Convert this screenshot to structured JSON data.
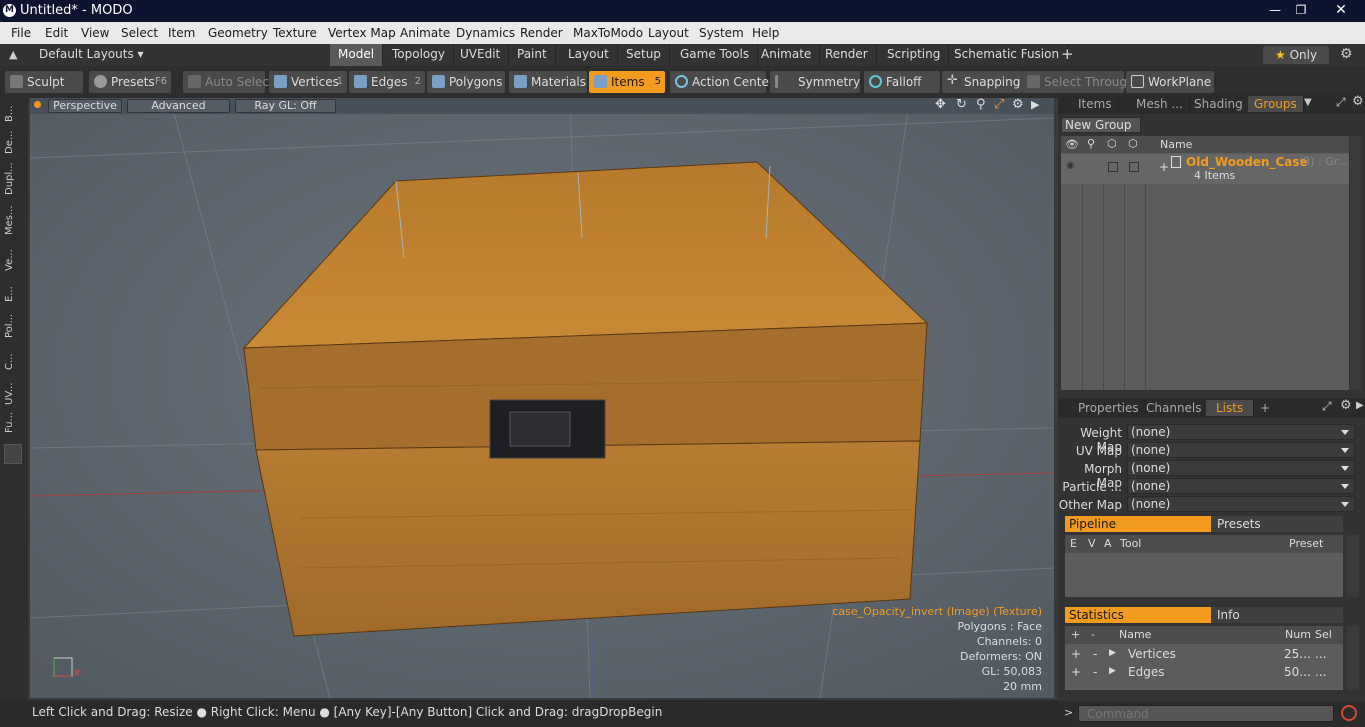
{
  "window": {
    "title": "Untitled* - MODO",
    "logo": "M"
  },
  "menu": [
    "File",
    "Edit",
    "View",
    "Select",
    "Item",
    "Geometry",
    "Texture",
    "Vertex Map",
    "Animate",
    "Dynamics",
    "Render",
    "MaxToModo",
    "Layout",
    "System",
    "Help"
  ],
  "layout_selector": "Default Layouts",
  "layout_tabs": [
    "Model",
    "Topology",
    "UVEdit",
    "Paint",
    "Layout",
    "Setup",
    "Game Tools",
    "Animate",
    "Render",
    "Scripting",
    "Schematic Fusion",
    "+"
  ],
  "only_label": "Only",
  "tools": {
    "sculpt": "Sculpt",
    "presets": "Presets",
    "presets_key": "F6",
    "auto_select": "Auto Select",
    "vertices": "Vertices",
    "vertices_key": "1",
    "edges": "Edges",
    "edges_key": "2",
    "polygons": "Polygons",
    "materials": "Materials",
    "items": "Items",
    "items_key": "5",
    "action_center": "Action Center",
    "symmetry": "Symmetry",
    "falloff": "Falloff",
    "snapping": "Snapping",
    "select_through": "Select Through",
    "workplane": "WorkPlane"
  },
  "left_tabs": [
    "B...",
    "De...",
    "Dupl...",
    "Mes...",
    "Ve...",
    "E...",
    "Pol...",
    "C...",
    "UV...",
    "Fu..."
  ],
  "viewport": {
    "perspective": "Perspective",
    "advanced": "Advanced",
    "raygl": "Ray GL: Off",
    "info": [
      "case_Opacity_invert (Image) (Texture)",
      "Polygons : Face",
      "Channels: 0",
      "Deformers: ON",
      "GL: 50,083",
      "20 mm"
    ]
  },
  "status_text": "Left Click and Drag: Resize ● Right Click: Menu ● [Any Key]-[Any Button] Click and Drag: dragDropBegin",
  "groups_panel": {
    "tabs": [
      "Items",
      "Mesh ...",
      "Shading",
      "Groups"
    ],
    "new_group": "New Group",
    "name_col": "Name",
    "item_name": "Old_Wooden_Case",
    "item_count": "(3) : Gr...",
    "item_sub": "4 Items"
  },
  "props_panel": {
    "tabs": [
      "Properties",
      "Channels",
      "Lists",
      "+"
    ],
    "maps": [
      {
        "label": "Weight Map",
        "value": "(none)"
      },
      {
        "label": "UV Map",
        "value": "(none)"
      },
      {
        "label": "Morph Map",
        "value": "(none)"
      },
      {
        "label": "Particle ...",
        "value": "(none)"
      },
      {
        "label": "Other Map",
        "value": "(none)"
      }
    ],
    "pipeline": "Pipeline",
    "presets": "Presets",
    "pipe_cols": [
      "E",
      "V",
      "A",
      "Tool",
      "Preset"
    ],
    "statistics": "Statistics",
    "info": "Info",
    "stat_cols": [
      "+",
      "-",
      "Name",
      "Num",
      "Sel"
    ],
    "stats": [
      {
        "name": "Vertices",
        "num": "25...",
        "sel": "..."
      },
      {
        "name": "Edges",
        "num": "50...",
        "sel": "..."
      }
    ]
  },
  "command_placeholder": "Command",
  "colors": {
    "accent": "#f39b1e",
    "title_bg": "#0c1430"
  }
}
